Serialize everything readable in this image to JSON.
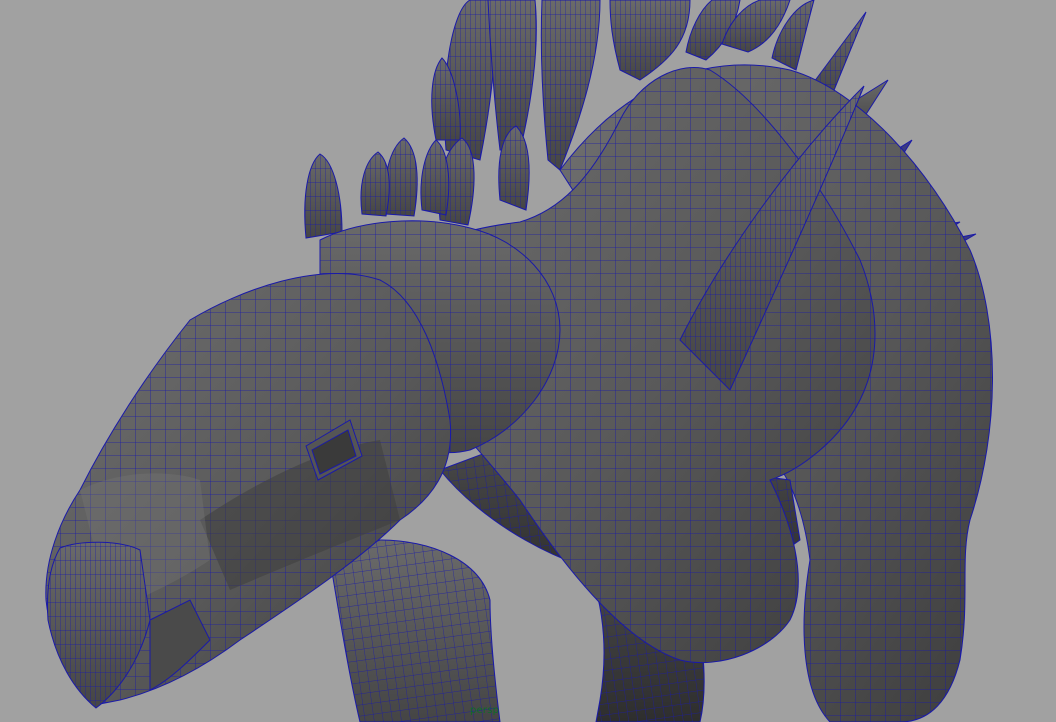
{
  "viewport": {
    "camera_label": "persp",
    "background_color": "#a1a1a1",
    "wire_color": "#1a1aa8",
    "camera_label_color": "#0f6b2a"
  },
  "scene": {
    "object": "stegosaurus-model",
    "display_mode": "smooth-shade-with-wireframe"
  }
}
